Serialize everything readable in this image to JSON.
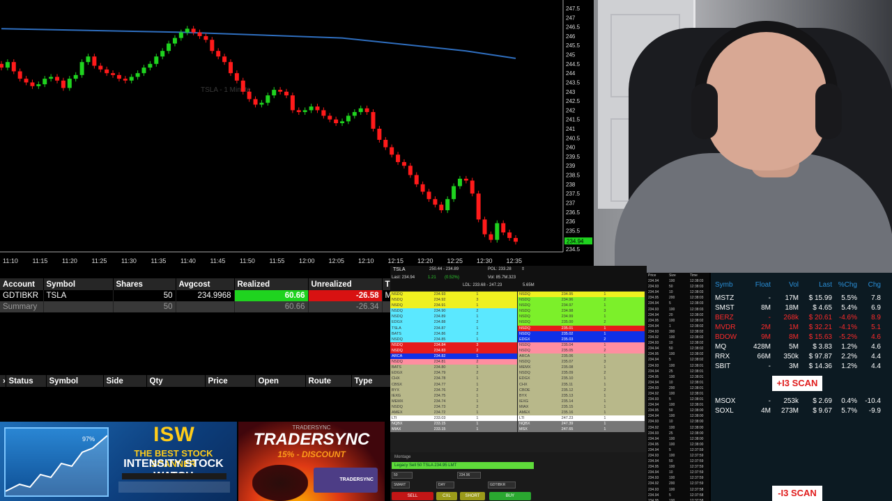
{
  "chart": {
    "watermark": "TSLA - 1 Minute",
    "price_labels": [
      "247.5",
      "247",
      "246.5",
      "246",
      "245.5",
      "245",
      "244.5",
      "244",
      "243.5",
      "243",
      "242.5",
      "242",
      "241.5",
      "241",
      "240.5",
      "240",
      "239.5",
      "239",
      "238.5",
      "238",
      "237.5",
      "237",
      "236.5",
      "236",
      "235.5",
      "235",
      "234.5"
    ],
    "current_price_label": "234.94",
    "time_labels": [
      "11:10",
      "11:15",
      "11:20",
      "11:25",
      "11:30",
      "11:35",
      "11:40",
      "11:45",
      "11:50",
      "11:55",
      "12:00",
      "12:05",
      "12:10",
      "12:15",
      "12:20",
      "12:25",
      "12:30",
      "12:35"
    ],
    "up_color": "#1fd31f",
    "down_color": "#ff1a1a",
    "ma_color": "#2f6fc0"
  },
  "chart_data": {
    "type": "candlestick",
    "title": "",
    "ylim": [
      234.5,
      247.8
    ],
    "x_labels": [
      "11:10",
      "11:15",
      "11:20",
      "11:25",
      "11:30",
      "11:35",
      "11:40",
      "11:45",
      "11:50",
      "11:55",
      "12:00",
      "12:05",
      "12:10",
      "12:15",
      "12:20",
      "12:25",
      "12:30",
      "12:35"
    ],
    "close_path": [
      244.3,
      244.6,
      244.1,
      243.7,
      243.5,
      243.3,
      243.4,
      243.7,
      243.8,
      243.6,
      243.2,
      243.7,
      243.9,
      244.6,
      244.9,
      244.4,
      244.2,
      244.0,
      243.9,
      243.7,
      243.6,
      243.8,
      244.0,
      244.3,
      244.5,
      244.9,
      245.2,
      245.6,
      245.9,
      246.2,
      246.4,
      246.2,
      246.0,
      245.8,
      245.2,
      244.9,
      244.6,
      244.0,
      243.6,
      243.0,
      242.6,
      242.3,
      242.4,
      242.8,
      243.1,
      243.0,
      242.8,
      242.0,
      241.9,
      242.0,
      242.2,
      242.0,
      241.7,
      241.5,
      241.3,
      241.4,
      241.7,
      241.9,
      242.1,
      241.9,
      241.0,
      240.4,
      240.0,
      239.6,
      239.2,
      239.0,
      238.5,
      238.0,
      237.6,
      237.2,
      236.9,
      236.6,
      237.2,
      237.9,
      238.3,
      238.2,
      237.5,
      236.1,
      235.3,
      235.0,
      235.9,
      235.4,
      235.1,
      234.9
    ],
    "moving_average": [
      {
        "t": 0,
        "v": 246.4
      },
      {
        "t": 30,
        "v": 246.2
      },
      {
        "t": 55,
        "v": 245.9
      },
      {
        "t": 75,
        "v": 245.2
      },
      {
        "t": 83,
        "v": 244.8
      }
    ]
  },
  "positions": {
    "headers": [
      "Account",
      "Symbol",
      "Shares",
      "Avgcost",
      "Realized",
      "Unrealized",
      "T"
    ],
    "rows": [
      {
        "account": "GDTIBKR",
        "symbol": "TSLA",
        "shares": "50",
        "avgcost": "234.9968",
        "realized": "60.66",
        "unrealized": "-26.58",
        "t": "M"
      }
    ],
    "summary": {
      "label": "Summary",
      "shares": "50",
      "realized": "60.66",
      "unrealized": "-26.34"
    }
  },
  "orders": {
    "headers": [
      "Status",
      "Symbol",
      "Side",
      "Qty",
      "Price",
      "Open",
      "Route",
      "Type"
    ]
  },
  "banners": {
    "isw": {
      "logo": "ISW",
      "tagline1": "THE BEST STOCK SCANNER",
      "tagline2": "INTENSITY STOCK WATCH",
      "chart_pct": "97%"
    },
    "tradersync": {
      "sub": "TRADERSYNC",
      "logo": "TRADERSYNC",
      "discount": "15% - DISCOUNT",
      "box": "TRADERSYNC"
    }
  },
  "level2": {
    "header": {
      "symbol": "TSLA",
      "range": "250.44 - 234.89",
      "pcl": "POL: 233.28",
      "last": "Last: 234.94",
      "change": "1.21",
      "pct": "(0.52%)",
      "vol": "Vol: 85.7M.323",
      "ldl": "LDL: 233.68 - 247.23",
      "ssr": "5.65M"
    },
    "bids": [
      [
        "NSDQ",
        "234.93",
        "1"
      ],
      [
        "NSDQ",
        "234.92",
        "3"
      ],
      [
        "NSDQ",
        "234.91",
        "1"
      ],
      [
        "NSDQ",
        "234.90",
        "2"
      ],
      [
        "NSDQ",
        "234.89",
        "1"
      ],
      [
        "EDGX",
        "234.88",
        "2"
      ],
      [
        "TSLA",
        "234.87",
        "1"
      ],
      [
        "BATS",
        "234.86",
        "2"
      ],
      [
        "NSDQ",
        "234.85",
        "1"
      ],
      [
        "NSDQ",
        "234.84",
        "3"
      ],
      [
        "NSDQ",
        "234.83",
        "2"
      ],
      [
        "ARCA",
        "234.82",
        "1"
      ],
      [
        "NSDQ",
        "234.81",
        "2"
      ],
      [
        "BATS",
        "234.80",
        "1"
      ],
      [
        "EDGX",
        "234.79",
        "2"
      ],
      [
        "CHX",
        "234.78",
        "1"
      ],
      [
        "CBSX",
        "234.77",
        "1"
      ],
      [
        "BYX",
        "234.76",
        "2"
      ],
      [
        "IEXG",
        "234.75",
        "1"
      ],
      [
        "MEMX",
        "234.74",
        "1"
      ],
      [
        "NSDQ",
        "234.73",
        "2"
      ],
      [
        "AMEX",
        "234.72",
        "1"
      ],
      [
        "LTI",
        "233.03",
        "1"
      ],
      [
        "NQBX",
        "233.15",
        "1"
      ],
      [
        "MIAX",
        "233.15",
        "1"
      ]
    ],
    "asks": [
      [
        "NSDQ",
        "234.95",
        "1"
      ],
      [
        "NSDQ",
        "234.96",
        "2"
      ],
      [
        "NSDQ",
        "234.97",
        "1"
      ],
      [
        "NSDQ",
        "234.98",
        "3"
      ],
      [
        "NSDQ",
        "234.99",
        "1"
      ],
      [
        "NSDQ",
        "235.00",
        "2"
      ],
      [
        "NSDQ",
        "235.01",
        "1"
      ],
      [
        "NSDQ",
        "235.02",
        "1"
      ],
      [
        "EDGX",
        "235.03",
        "2"
      ],
      [
        "NSDQ",
        "235.04",
        "1"
      ],
      [
        "NSDQ",
        "235.05",
        "2"
      ],
      [
        "ARCA",
        "235.06",
        "1"
      ],
      [
        "NSDQ",
        "235.07",
        "3"
      ],
      [
        "MEMX",
        "235.08",
        "1"
      ],
      [
        "NSDQ",
        "235.09",
        "2"
      ],
      [
        "EDGX",
        "235.10",
        "1"
      ],
      [
        "CHX",
        "235.11",
        "1"
      ],
      [
        "CBOE",
        "235.12",
        "2"
      ],
      [
        "BYX",
        "235.13",
        "1"
      ],
      [
        "IEXG",
        "235.14",
        "1"
      ],
      [
        "MIAX",
        "235.15",
        "1"
      ],
      [
        "AMEX",
        "235.16",
        "1"
      ],
      [
        "LTI",
        "247.23",
        "1"
      ],
      [
        "NQBX",
        "247.39",
        "1"
      ],
      [
        "MSX",
        "247.65",
        "1"
      ]
    ],
    "montage": {
      "label": "Montage",
      "symbol_info": "Legacy Sell 50 TSLA 234.95 LMT",
      "qty": "50",
      "price": "234.96",
      "tif": "DAY",
      "route": "SMART",
      "account": "GDTIBKR",
      "sell": "SELL",
      "cxl": "CXL",
      "buy": "BUY",
      "short": "SHORT"
    }
  },
  "time_sales": {
    "header": [
      "Price",
      "Size",
      "Time"
    ],
    "rows": [
      [
        "234.94",
        "100",
        "12:38:03"
      ],
      [
        "234.93",
        "50",
        "12:38:03"
      ],
      [
        "234.94",
        "10",
        "12:38:03"
      ],
      [
        "234.95",
        "200",
        "12:38:03"
      ],
      [
        "234.94",
        "5",
        "12:38:03"
      ],
      [
        "234.93",
        "100",
        "12:38:03"
      ],
      [
        "234.94",
        "20",
        "12:38:02"
      ],
      [
        "234.95",
        "100",
        "12:38:02"
      ],
      [
        "234.94",
        "1",
        "12:38:02"
      ],
      [
        "234.93",
        "300",
        "12:38:02"
      ],
      [
        "234.92",
        "100",
        "12:38:02"
      ],
      [
        "234.93",
        "10",
        "12:38:02"
      ],
      [
        "234.94",
        "50",
        "12:38:02"
      ],
      [
        "234.95",
        "100",
        "12:38:02"
      ],
      [
        "234.94",
        "5",
        "12:38:02"
      ],
      [
        "234.93",
        "100",
        "12:38:01"
      ],
      [
        "234.94",
        "25",
        "12:38:01"
      ],
      [
        "234.95",
        "100",
        "12:38:01"
      ],
      [
        "234.94",
        "10",
        "12:38:01"
      ],
      [
        "234.93",
        "200",
        "12:38:01"
      ],
      [
        "234.92",
        "100",
        "12:38:01"
      ],
      [
        "234.93",
        "5",
        "12:38:01"
      ],
      [
        "234.94",
        "100",
        "12:38:01"
      ],
      [
        "234.95",
        "50",
        "12:38:00"
      ],
      [
        "234.94",
        "100",
        "12:38:00"
      ],
      [
        "234.93",
        "10",
        "12:38:00"
      ],
      [
        "234.92",
        "100",
        "12:38:00"
      ],
      [
        "234.93",
        "25",
        "12:38:00"
      ],
      [
        "234.94",
        "100",
        "12:38:00"
      ],
      [
        "234.95",
        "100",
        "12:38:00"
      ],
      [
        "234.94",
        "5",
        "12:37:59"
      ],
      [
        "234.93",
        "100",
        "12:37:59"
      ],
      [
        "234.94",
        "50",
        "12:37:59"
      ],
      [
        "234.95",
        "100",
        "12:37:59"
      ],
      [
        "234.94",
        "10",
        "12:37:59"
      ],
      [
        "234.93",
        "100",
        "12:37:59"
      ],
      [
        "234.92",
        "200",
        "12:37:59"
      ],
      [
        "234.93",
        "100",
        "12:37:58"
      ],
      [
        "234.94",
        "5",
        "12:37:58"
      ],
      [
        "234.95",
        "100",
        "12:37:58"
      ]
    ]
  },
  "scanner": {
    "headers": [
      "Symb",
      "Float",
      "Vol",
      "Last",
      "%Chg",
      "Chg"
    ],
    "rows_top": [
      {
        "sym": "MSTZ",
        "float": "-",
        "vol": "17M",
        "last": "$ 15.99",
        "pct": "5.5%",
        "chg": "7.8",
        "color": "#ffffff"
      },
      {
        "sym": "SMST",
        "float": "8M",
        "vol": "18M",
        "last": "$ 4.65",
        "pct": "5.4%",
        "chg": "6.9",
        "color": "#ffffff"
      },
      {
        "sym": "BERZ",
        "float": "-",
        "vol": "268k",
        "last": "$ 20.61",
        "pct": "-4.6%",
        "chg": "8.9",
        "color": "#ff2a2a"
      },
      {
        "sym": "MVDR",
        "float": "2M",
        "vol": "1M",
        "last": "$ 32.21",
        "pct": "-4.1%",
        "chg": "5.1",
        "color": "#ff2a2a"
      },
      {
        "sym": "BDOW",
        "float": "9M",
        "vol": "8M",
        "last": "$ 15.63",
        "pct": "-5.2%",
        "chg": "4.6",
        "color": "#ff2a2a"
      },
      {
        "sym": "MQ",
        "float": "428M",
        "vol": "5M",
        "last": "$ 3.83",
        "pct": "1.2%",
        "chg": "4.6",
        "color": "#ffffff"
      },
      {
        "sym": "RRX",
        "float": "66M",
        "vol": "350k",
        "last": "$ 97.87",
        "pct": "2.2%",
        "chg": "4.4",
        "color": "#ffffff"
      },
      {
        "sym": "SBIT",
        "float": "-",
        "vol": "3M",
        "last": "$ 14.36",
        "pct": "1.2%",
        "chg": "4.4",
        "color": "#ffffff"
      }
    ],
    "badge_top": "+I3 SCAN",
    "rows_bottom": [
      {
        "sym": "MSOX",
        "float": "-",
        "vol": "253k",
        "last": "$ 2.69",
        "pct": "0.4%",
        "chg": "-10.4",
        "color": "#ffffff"
      },
      {
        "sym": "SOXL",
        "float": "4M",
        "vol": "273M",
        "last": "$ 9.67",
        "pct": "5.7%",
        "chg": "-9.9",
        "color": "#ffffff"
      }
    ],
    "badge_bottom": "-I3 SCAN"
  }
}
